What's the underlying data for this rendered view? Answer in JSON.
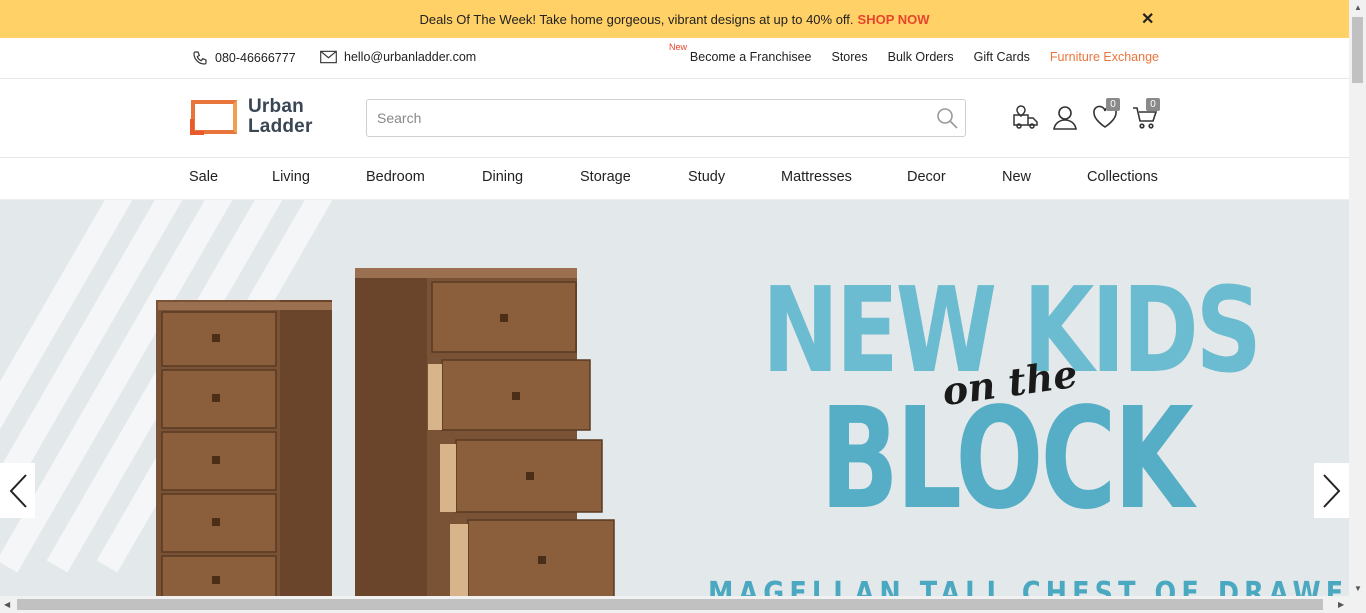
{
  "promo": {
    "text": "Deals Of The Week! Take home gorgeous, vibrant designs at up to 40% off.",
    "cta": "SHOP NOW",
    "close": "✕"
  },
  "contact": {
    "phone": "080-46666777",
    "email": "hello@urbanladder.com"
  },
  "util_links": {
    "new_tag": "New",
    "franchise": "Become a Franchisee",
    "stores": "Stores",
    "bulk": "Bulk Orders",
    "gift": "Gift Cards",
    "exchange": "Furniture Exchange"
  },
  "logo": {
    "line1": "Urban",
    "line2": "Ladder"
  },
  "search": {
    "placeholder": "Search"
  },
  "header_icons": {
    "wishlist_count": "0",
    "cart_count": "0"
  },
  "nav": [
    "Sale",
    "Living",
    "Bedroom",
    "Dining",
    "Storage",
    "Study",
    "Mattresses",
    "Decor",
    "New",
    "Collections"
  ],
  "hero": {
    "line1": "NEW KIDS",
    "line2": "BLOCK",
    "script": "on the",
    "subline": "MAGELLAN TALL CHEST OF DRAWERS"
  },
  "colors": {
    "promo_bg": "#ffd166",
    "accent": "#e8763c",
    "hero_text": "#6bbcd0",
    "hero_bg": "#e3e8ea"
  }
}
